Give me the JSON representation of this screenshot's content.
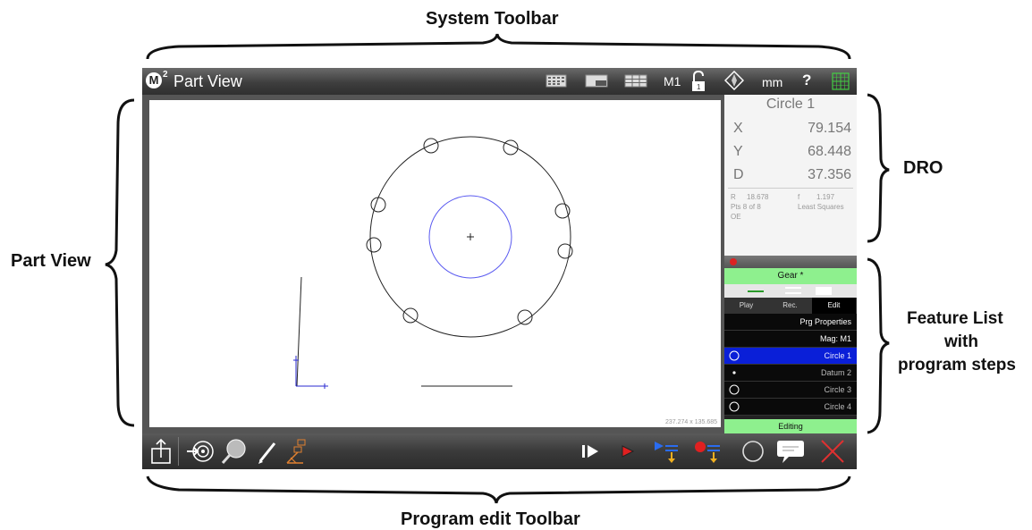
{
  "callouts": {
    "system_toolbar": "System Toolbar",
    "dro": "DRO",
    "part_view": "Part View",
    "feature_list": [
      "Feature List",
      "with",
      "program steps"
    ],
    "program_edit_toolbar": "Program edit Toolbar"
  },
  "titlebar": {
    "logo": "M",
    "logo_sup": "2",
    "title": "Part View",
    "icons": [
      "keypad-icon",
      "window-layout-icon",
      "grid-layout-icon",
      "magnification-label",
      "lock-open-icon",
      "compass-icon",
      "units-label",
      "help-icon",
      "crosshair-grid-icon"
    ],
    "magnification": "M1",
    "units": "mm",
    "help": "?"
  },
  "viewport": {
    "coords": "237.274 x 135.685"
  },
  "dro": {
    "feature_name": "Circle 1",
    "rows": [
      {
        "axis": "X",
        "value": "79.154"
      },
      {
        "axis": "Y",
        "value": "68.448"
      },
      {
        "axis": "D",
        "value": "37.356"
      }
    ],
    "r_label": "R",
    "r_value": "18.678",
    "f_label": "f",
    "f_value": "1.197",
    "points": "Pts 8 of 8",
    "fit": "Least Squares",
    "oe": "OE"
  },
  "feature_list": {
    "program_name": "Gear *",
    "tabs": [
      "Play",
      "Rec.",
      "Edit"
    ],
    "active_tab": "Edit",
    "rows": [
      {
        "label": "Prg Properties",
        "icon": ""
      },
      {
        "label": "Mag: M1",
        "icon": ""
      },
      {
        "label": "Circle 1",
        "icon": "circle-icon"
      },
      {
        "label": "Datum 2",
        "icon": "point-icon"
      },
      {
        "label": "Circle 3",
        "icon": "circle-icon"
      },
      {
        "label": "Circle 4",
        "icon": "circle-icon"
      }
    ],
    "selected": "Circle 1",
    "status": "Editing",
    "colors": {
      "status_green": "#8ef08e",
      "selected_blue": "#0a1fd8"
    }
  },
  "bottom_toolbar": {
    "icons": [
      "export-icon",
      "probe-target-icon",
      "magnifier-icon",
      "pencil-icon",
      "construct-icon",
      "step-play-icon",
      "run-icon",
      "insert-step-icon",
      "record-insert-icon",
      "circle-refresh-icon",
      "comment-icon",
      "delete-icon"
    ]
  }
}
